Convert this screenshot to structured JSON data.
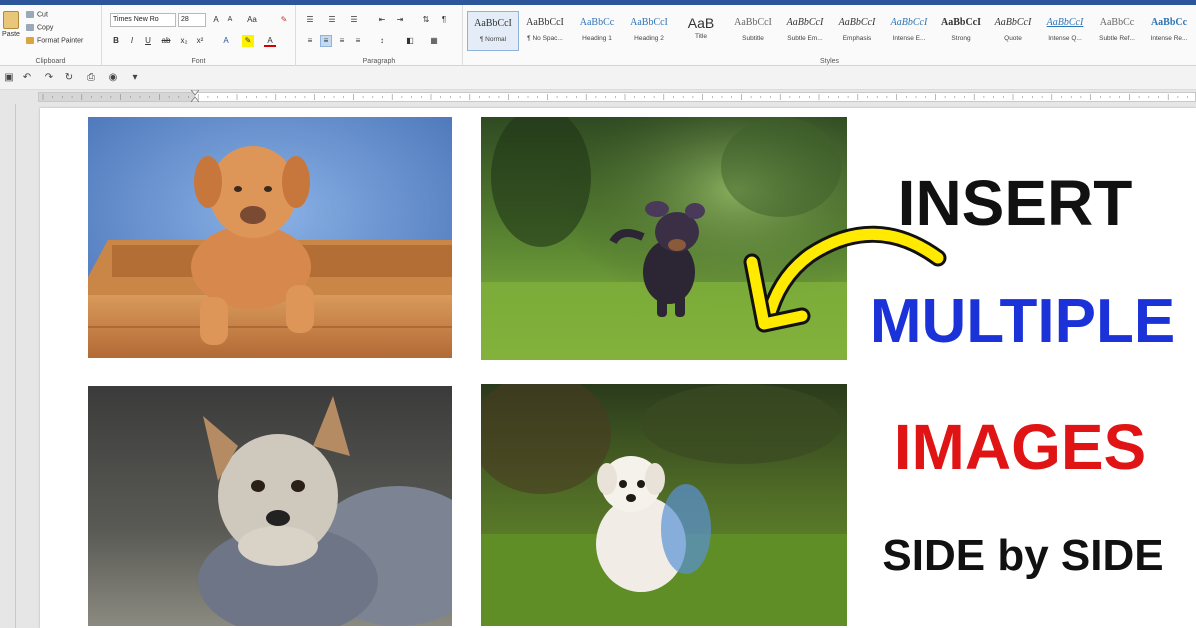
{
  "ribbon": {
    "clipboard": {
      "paste_label": "Paste",
      "cut_label": "Cut",
      "copy_label": "Copy",
      "format_painter_label": "Format Painter",
      "group_label": "Clipboard"
    },
    "font": {
      "font_name": "Times New Ro",
      "font_size": "28",
      "group_label": "Font",
      "bold": "B",
      "italic": "I",
      "underline": "U"
    },
    "paragraph": {
      "group_label": "Paragraph"
    },
    "styles": {
      "group_label": "Styles",
      "items": [
        {
          "sample": "AaBbCcI",
          "name": "¶ Normal"
        },
        {
          "sample": "AaBbCcI",
          "name": "¶ No Spac..."
        },
        {
          "sample": "AaBbCc",
          "name": "Heading 1"
        },
        {
          "sample": "AaBbCcI",
          "name": "Heading 2"
        },
        {
          "sample": "AaB",
          "name": "Title"
        },
        {
          "sample": "AaBbCcI",
          "name": "Subtitle"
        },
        {
          "sample": "AaBbCcI",
          "name": "Subtle Em..."
        },
        {
          "sample": "AaBbCcI",
          "name": "Emphasis"
        },
        {
          "sample": "AaBbCcI",
          "name": "Intense E..."
        },
        {
          "sample": "AaBbCcI",
          "name": "Strong"
        },
        {
          "sample": "AaBbCcI",
          "name": "Quote"
        },
        {
          "sample": "AaBbCcI",
          "name": "Intense Q..."
        },
        {
          "sample": "AaBbCc",
          "name": "Subtle Ref..."
        },
        {
          "sample": "AaBbCc",
          "name": "Intense Re..."
        }
      ]
    }
  },
  "document": {
    "caption": {
      "line1": "INSERT",
      "line2": "MULTIPLE",
      "line3": "IMAGES",
      "line4": "SIDE by SIDE"
    },
    "colors": {
      "insert": "#111111",
      "multiple": "#1a32d8",
      "images": "#e01414",
      "side": "#111111",
      "arrow": "#ffea00"
    },
    "images": [
      "puppy-in-wooden-box",
      "puppy-running-on-grass",
      "yorkshire-terrier",
      "white-puppy-in-grass"
    ]
  }
}
